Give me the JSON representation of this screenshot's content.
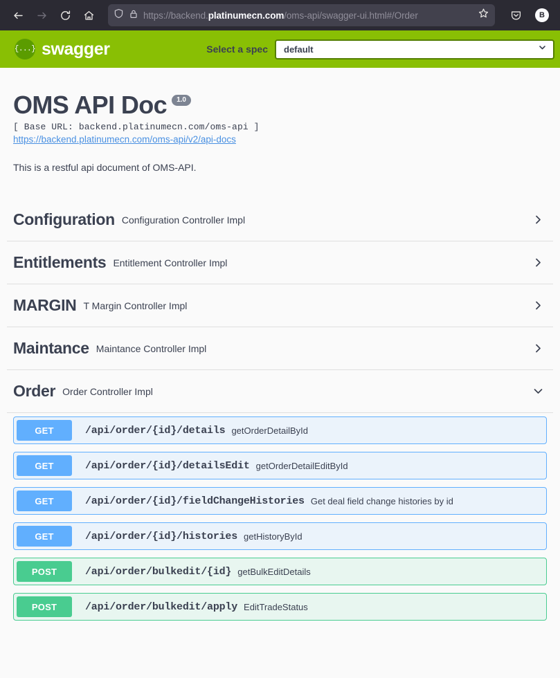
{
  "browser": {
    "back_icon": "back-arrow-icon",
    "forward_icon": "forward-arrow-icon",
    "reload_icon": "reload-icon",
    "home_icon": "home-icon",
    "shield_icon": "shield-icon",
    "lock_icon": "lock-icon",
    "bookmark_icon": "star-icon",
    "pocket_icon": "pocket-icon",
    "url_scheme": "https://backend.",
    "url_host": "platinumecn.com",
    "url_path": "/oms-api/swagger-ui.html#/Order",
    "url_full": "https://backend.platinumecn.com/oms-api/swagger-ui.html#/Order",
    "profile_initial": "B"
  },
  "topbar": {
    "logo_mark": "{...}",
    "logo_text": "swagger",
    "spec_label": "Select a spec",
    "spec_selected": "default",
    "spec_options": [
      "default"
    ],
    "accent_color": "#89bf04",
    "select_border_color": "#547f00"
  },
  "info": {
    "title": "OMS API Doc",
    "version": "1.0",
    "base_url": "[ Base URL: backend.platinumecn.com/oms-api ]",
    "docs_link": "https://backend.platinumecn.com/oms-api/v2/api-docs",
    "description": "This is a restful api document of OMS-API."
  },
  "tags": [
    {
      "name": "Configuration",
      "description": "Configuration Controller Impl",
      "expanded": false,
      "arrow_icon": "chevron-right-icon",
      "operations": []
    },
    {
      "name": "Entitlements",
      "description": "Entitlement Controller Impl",
      "expanded": false,
      "arrow_icon": "chevron-right-icon",
      "operations": []
    },
    {
      "name": "MARGIN",
      "description": "T Margin Controller Impl",
      "expanded": false,
      "arrow_icon": "chevron-right-icon",
      "operations": []
    },
    {
      "name": "Maintance",
      "description": "Maintance Controller Impl",
      "expanded": false,
      "arrow_icon": "chevron-right-icon",
      "operations": []
    },
    {
      "name": "Order",
      "description": "Order Controller Impl",
      "expanded": true,
      "arrow_icon": "chevron-down-icon",
      "operations": [
        {
          "method": "GET",
          "path": "/api/order/{id}/details",
          "summary": "getOrderDetailById",
          "color": "#61affe"
        },
        {
          "method": "GET",
          "path": "/api/order/{id}/detailsEdit",
          "summary": "getOrderDetailEditById",
          "color": "#61affe"
        },
        {
          "method": "GET",
          "path": "/api/order/{id}/fieldChangeHistories",
          "summary": "Get deal field change histories by id",
          "color": "#61affe"
        },
        {
          "method": "GET",
          "path": "/api/order/{id}/histories",
          "summary": "getHistoryById",
          "color": "#61affe"
        },
        {
          "method": "POST",
          "path": "/api/order/bulkedit/{id}",
          "summary": "getBulkEditDetails",
          "color": "#49cc90"
        },
        {
          "method": "POST",
          "path": "/api/order/bulkedit/apply",
          "summary": "EditTradeStatus",
          "color": "#49cc90"
        }
      ]
    }
  ]
}
